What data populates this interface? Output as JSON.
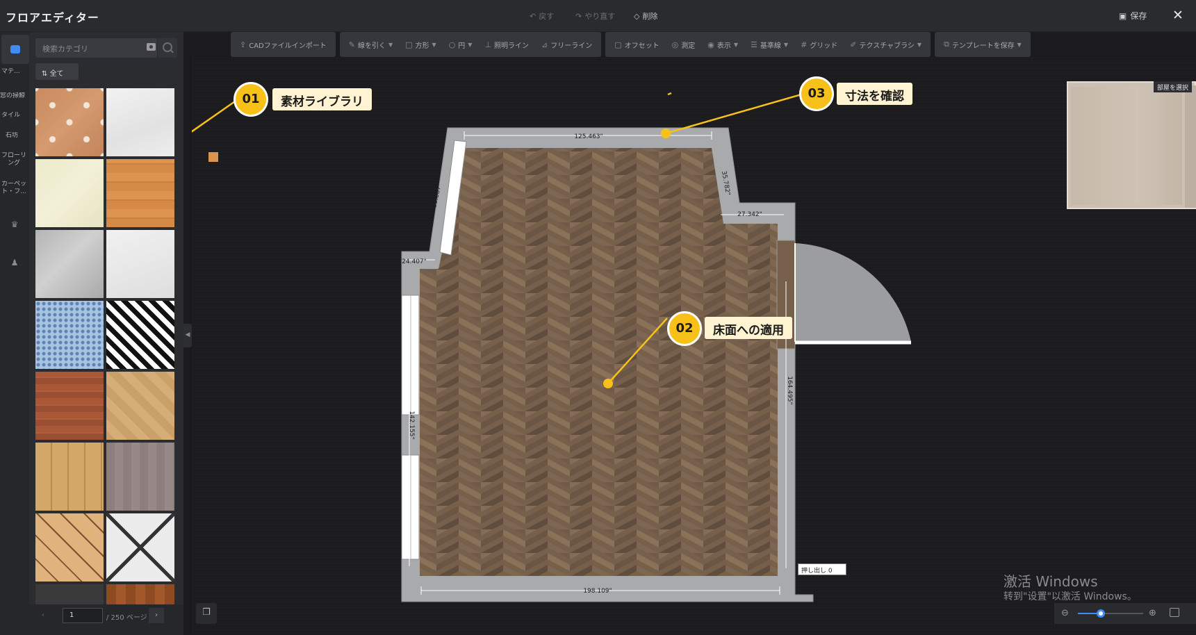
{
  "titlebar": {
    "title": "フロアエディター",
    "undo": "戻す",
    "redo": "やり直す",
    "delete": "削除",
    "save": "保存",
    "close": "✕"
  },
  "rail": {
    "items": [
      "マテ...",
      "窓の掃鯨",
      "タイル",
      "石坊",
      "フローリング",
      "カーペット・フ..."
    ]
  },
  "panel": {
    "search_placeholder": "検索カテゴリ",
    "all_button": "全て",
    "page_current": "1",
    "page_total": "/ 250 ページ"
  },
  "toolbar": {
    "cad_import": "CADファイルインポート",
    "draw_wall": "線を引く",
    "rect": "方形",
    "circle": "円",
    "light_line": "照明ライン",
    "free_line": "フリーライン",
    "offset": "オフセット",
    "measure": "測定",
    "display": "表示",
    "baseline": "基準線",
    "grid": "グリッド",
    "texture_brush": "テクスチャブラシ",
    "save_template": "テンプレートを保存"
  },
  "canvas": {
    "dimensions": {
      "top": "125.463\"",
      "diag_left": "59.067\"",
      "diag_right": "35.782\"",
      "step_right": "27.342\"",
      "step_left": "24.407\"",
      "left": "142.155\"",
      "right": "164.495\"",
      "bottom": "198.109\""
    },
    "extrude_label": "押し出し 0",
    "preview_tag": "部屋を選択"
  },
  "callouts": [
    {
      "num": "01",
      "label": "素材ライブラリ"
    },
    {
      "num": "02",
      "label": "床面への適用"
    },
    {
      "num": "03",
      "label": "寸法を確認"
    }
  ],
  "watermark": {
    "line1": "激活 Windows",
    "line2": "转到\"设置\"以激活 Windows。"
  },
  "zoom": {
    "level": 0.35
  },
  "colors": {
    "accent": "#3f8cf5",
    "callout": "#f7c11a"
  }
}
